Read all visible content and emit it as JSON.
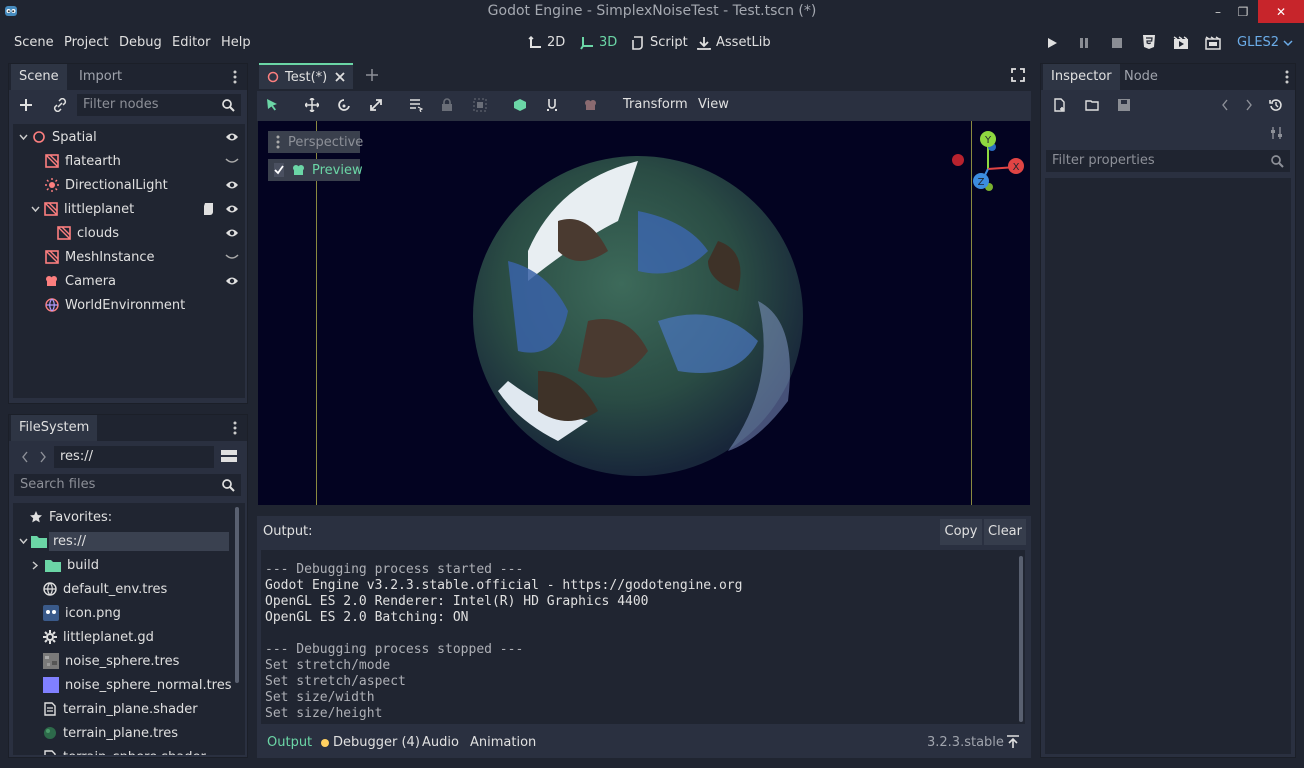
{
  "window": {
    "title": "Godot Engine - SimplexNoiseTest - Test.tscn (*)"
  },
  "menu": {
    "items": [
      "Scene",
      "Project",
      "Debug",
      "Editor",
      "Help"
    ]
  },
  "workspaces": {
    "items": [
      "2D",
      "3D",
      "Script",
      "AssetLib"
    ],
    "active": "3D"
  },
  "renderer": "GLES2",
  "scene_dock": {
    "tabs": [
      "Scene",
      "Import"
    ],
    "filter_placeholder": "Filter nodes",
    "nodes": [
      {
        "label": "Spatial",
        "icon": "spatial-icon",
        "visible": "eye"
      },
      {
        "label": "flatearth",
        "icon": "mesh-instance-icon",
        "visible": "hidden"
      },
      {
        "label": "DirectionalLight",
        "icon": "directional-light-icon",
        "visible": "eye"
      },
      {
        "label": "littleplanet",
        "icon": "mesh-instance-icon",
        "visible": "eye",
        "script": true
      },
      {
        "label": "clouds",
        "icon": "mesh-instance-icon",
        "visible": "eye"
      },
      {
        "label": "MeshInstance",
        "icon": "mesh-instance-icon",
        "visible": "hidden"
      },
      {
        "label": "Camera",
        "icon": "camera-icon",
        "visible": "eye"
      },
      {
        "label": "WorldEnvironment",
        "icon": "world-environment-icon",
        "visible": "none"
      }
    ]
  },
  "filesystem": {
    "tab": "FileSystem",
    "path": "res://",
    "search_placeholder": "Search files",
    "favorites": "Favorites:",
    "root": "res://",
    "items": [
      {
        "label": "build",
        "icon": "folder-icon"
      },
      {
        "label": "default_env.tres",
        "icon": "environment-icon"
      },
      {
        "label": "icon.png",
        "icon": "image-icon"
      },
      {
        "label": "littleplanet.gd",
        "icon": "gear-icon"
      },
      {
        "label": "noise_sphere.tres",
        "icon": "noise-texture-icon"
      },
      {
        "label": "noise_sphere_normal.tres",
        "icon": "normal-texture-icon"
      },
      {
        "label": "terrain_plane.shader",
        "icon": "shader-icon"
      },
      {
        "label": "terrain_plane.tres",
        "icon": "material-icon"
      },
      {
        "label": "terrain_sphere.shader",
        "icon": "shader-icon"
      }
    ]
  },
  "editor": {
    "tab_label": "Test(*)",
    "toolbar": {
      "transform": "Transform",
      "view": "View"
    },
    "viewport": {
      "perspective": "Perspective",
      "preview": "Preview",
      "gizmo_axes": [
        "Y",
        "X",
        "Z"
      ]
    }
  },
  "output": {
    "title": "Output:",
    "copy": "Copy",
    "clear": "Clear",
    "lines": [
      "--- Debugging process started ---",
      "Godot Engine v3.2.3.stable.official - https://godotengine.org",
      "OpenGL ES 2.0 Renderer: Intel(R) HD Graphics 4400",
      "OpenGL ES 2.0 Batching: ON",
      "",
      "--- Debugging process stopped ---",
      "Set stretch/mode",
      "Set stretch/aspect",
      "Set size/width",
      "Set size/height"
    ]
  },
  "bottom_tabs": {
    "output": "Output",
    "debugger": "Debugger (4)",
    "audio": "Audio",
    "animation": "Animation",
    "version": "3.2.3.stable"
  },
  "inspector": {
    "tabs": [
      "Inspector",
      "Node"
    ],
    "filter_placeholder": "Filter properties"
  },
  "colors": {
    "accent": "#6bd6a6",
    "background": "#202531",
    "panel": "#2a3040"
  }
}
